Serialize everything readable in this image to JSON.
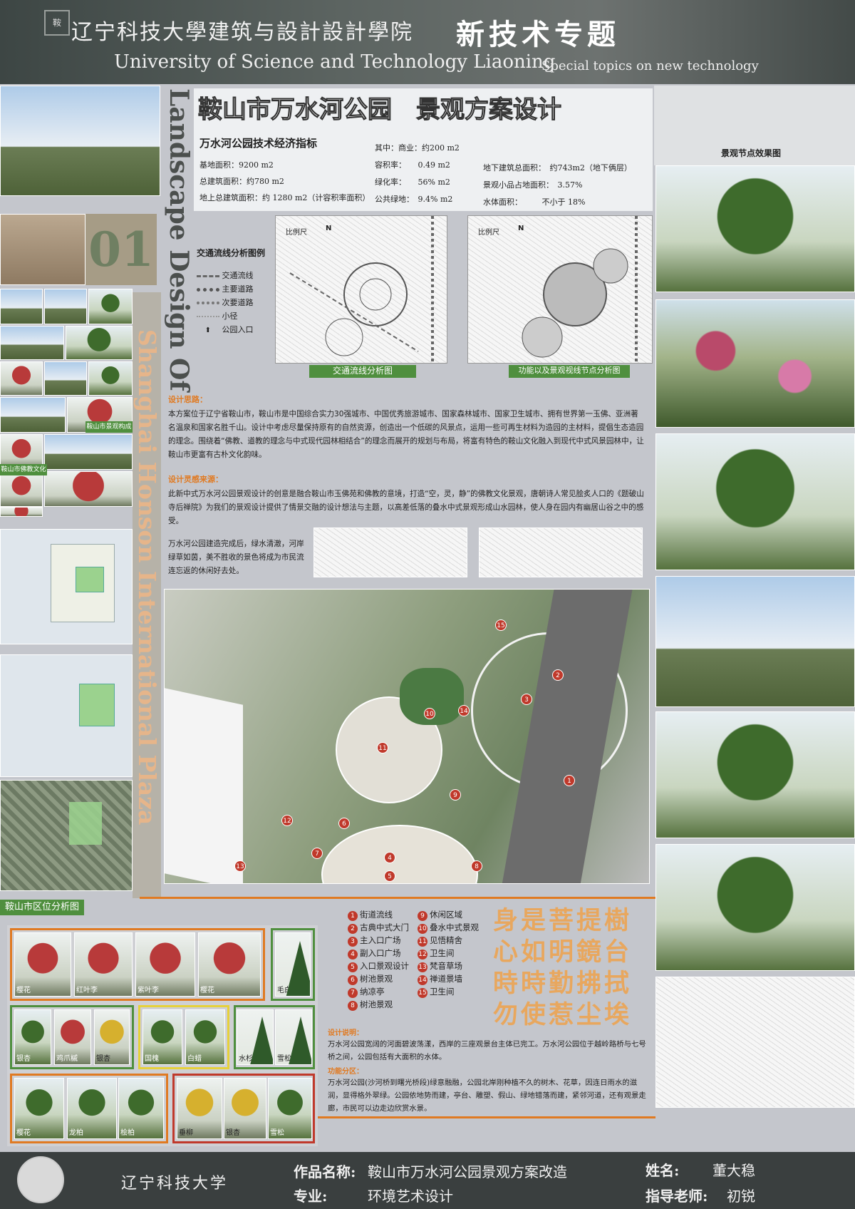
{
  "header": {
    "school": "辽宁科技大學建筑与設計設計學院",
    "topic": "新技术专题",
    "english": "University of Science and Technology Liaoning",
    "english_topic": "Special topics on new technology"
  },
  "project": {
    "title": "鞍山市万水河公园　景观方案设计",
    "number": "01",
    "vertical_title": "Landscape Design Of",
    "vertical_subtitle": "Shanghai Honson International Plaza"
  },
  "indicators": {
    "heading": "万水河公园技术经济指标",
    "col1": [
      "基地面积：9200 m2",
      "总建筑面积：约780 m2",
      "地上总建筑面积：约 1280 m2（计容积率面积）"
    ],
    "col2": [
      "其中：商业：约200 m2",
      "容积率：　　0.49 m2",
      "绿化率：　　56% m2",
      "公共绿地：　9.4% m2"
    ],
    "col3": [
      "地下建筑总面积：　约743m2（地下俩层）",
      "景观小品占地面积：　3.57%",
      "水体面积：　　　不小于 18%"
    ]
  },
  "traffic_legend": {
    "title": "交通流线分析图例",
    "items": [
      "交通流线",
      "主要道路",
      "次要道路",
      "小径",
      "公园入口"
    ],
    "scale": "比例尺",
    "north": "N"
  },
  "plans": {
    "left_caption": "交通流线分析图",
    "right_caption": "功能以及景观视线节点分析图"
  },
  "design": {
    "idea_heading": "设计思路：",
    "idea_text": "本方案位于辽宁省鞍山市，鞍山市是中国综合实力30强城市、中国优秀旅游城市、国家森林城市、国家卫生城市、拥有世界第一玉佛、亚洲著名温泉和国家名胜千山。设计中考虑尽量保持原有的自然资源，创造出一个低碳的风景点，运用一些可再生材料为造园的主材料，提倡生态造园的理念。围绕着“佛教、道教的理念与中式现代园林相结合”的理念而展开的规划与布局，将富有特色的鞍山文化融入到现代中式风景园林中，让鞍山市更富有古朴文化韵味。",
    "source_heading": "设计灵感来源：",
    "source_text": "此新中式万水河公园景观设计的创意是融合鞍山市玉佛苑和佛教的意境，打造“空，灵，静”的佛教文化景观，唐朝诗人常见脍炙人口的《题破山寺后禅院》为我们的景观设计提供了情景交融的设计想法与主题，以高差低落的叠水中式景观形成山水园林，使人身在园内有幽居山谷之中的感受。",
    "source_text2": "万水河公园建造完成后，绿水清澈，河岸绿草如茵，美不胜收的景色将成为市民流连忘返的休闲好去处。"
  },
  "region_label": "鞍山市区位分析图",
  "side_left": {
    "caption1": "鞍山市景观构成",
    "caption2": "鞍山市佛教文化"
  },
  "nodes_title": "景观节点效果图",
  "legend_left": [
    "街道流线",
    "古典中式大门",
    "主入口广场",
    "副入口广场",
    "入口景观设计",
    "树池景观",
    "纳凉亭",
    "树池景观"
  ],
  "legend_right": [
    "休闲区域",
    "叠水中式景观",
    "见悟精舍",
    "卫生间",
    "梵音草场",
    "禅道景墙",
    "卫生间"
  ],
  "poem": [
    "身是菩提樹",
    "心如明鏡台",
    "時時勤拂拭",
    "勿使惹尘埃"
  ],
  "notes": {
    "h1": "设计说明：",
    "t1": "万水河公园宽阔的河面碧波荡漾，西岸的三座观景台主体已完工。万水河公园位于越岭路桥与七号桥之间，公园包括有大面积的水体。",
    "h2": "功能分区：",
    "t2": "万水河公园(沙河桥到曙光桥段)绿意融融，公园北岸刚种植不久的树木、花草，因连日雨水的滋润，显得格外翠绿。公园依地势而建，亭台、雕塑、假山、绿地错落而建，紧邻河道，还有观景走廊，市民可以边走边欣赏水景。"
  },
  "trees": [
    "樱花",
    "红叶李",
    "紫叶李",
    "樱花",
    "毛白杨",
    "银杏",
    "鸡爪槭",
    "银杏",
    "国槐",
    "白蜡",
    "水杉",
    "雪松",
    "樱花",
    "龙柏",
    "桧柏",
    "垂柳",
    "银杏",
    "雪松"
  ],
  "footer": {
    "university": "辽宁科技大学",
    "work_label": "作品名称:",
    "work_value": "鞍山市万水河公园景观方案改造",
    "major_label": "专业:",
    "major_value": "环境艺术设计",
    "name_label": "姓名:",
    "name_value": "董大稳",
    "teacher_label": "指导老师:",
    "teacher_value": "初锐"
  },
  "colors": {
    "header_bg": "#4a4f4d",
    "accent_orange": "#e07a22",
    "green_label": "#4f8f3e",
    "pin_red": "#c0392b",
    "footer_bg": "#3a3f3f"
  }
}
